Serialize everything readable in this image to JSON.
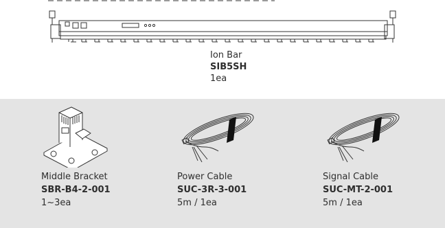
{
  "top_cropped_text": "",
  "main_item": {
    "name": "Ion Bar",
    "code": "SIB5SH",
    "qty": "1ea"
  },
  "accessories": [
    {
      "name": "Middle Bracket",
      "code": "SBR-B4-2-001",
      "qty": "1~3ea",
      "icon": "bracket-illustration"
    },
    {
      "name": "Power Cable",
      "code": "SUC-3R-3-001",
      "qty": "5m / 1ea",
      "icon": "coiled-cable-illustration"
    },
    {
      "name": "Signal Cable",
      "code": "SUC-MT-2-001",
      "qty": "5m / 1ea",
      "icon": "coiled-cable-illustration"
    }
  ],
  "colors": {
    "panel_bg": "#e4e4e4",
    "text": "#2e2e2e",
    "line": "#333333"
  }
}
